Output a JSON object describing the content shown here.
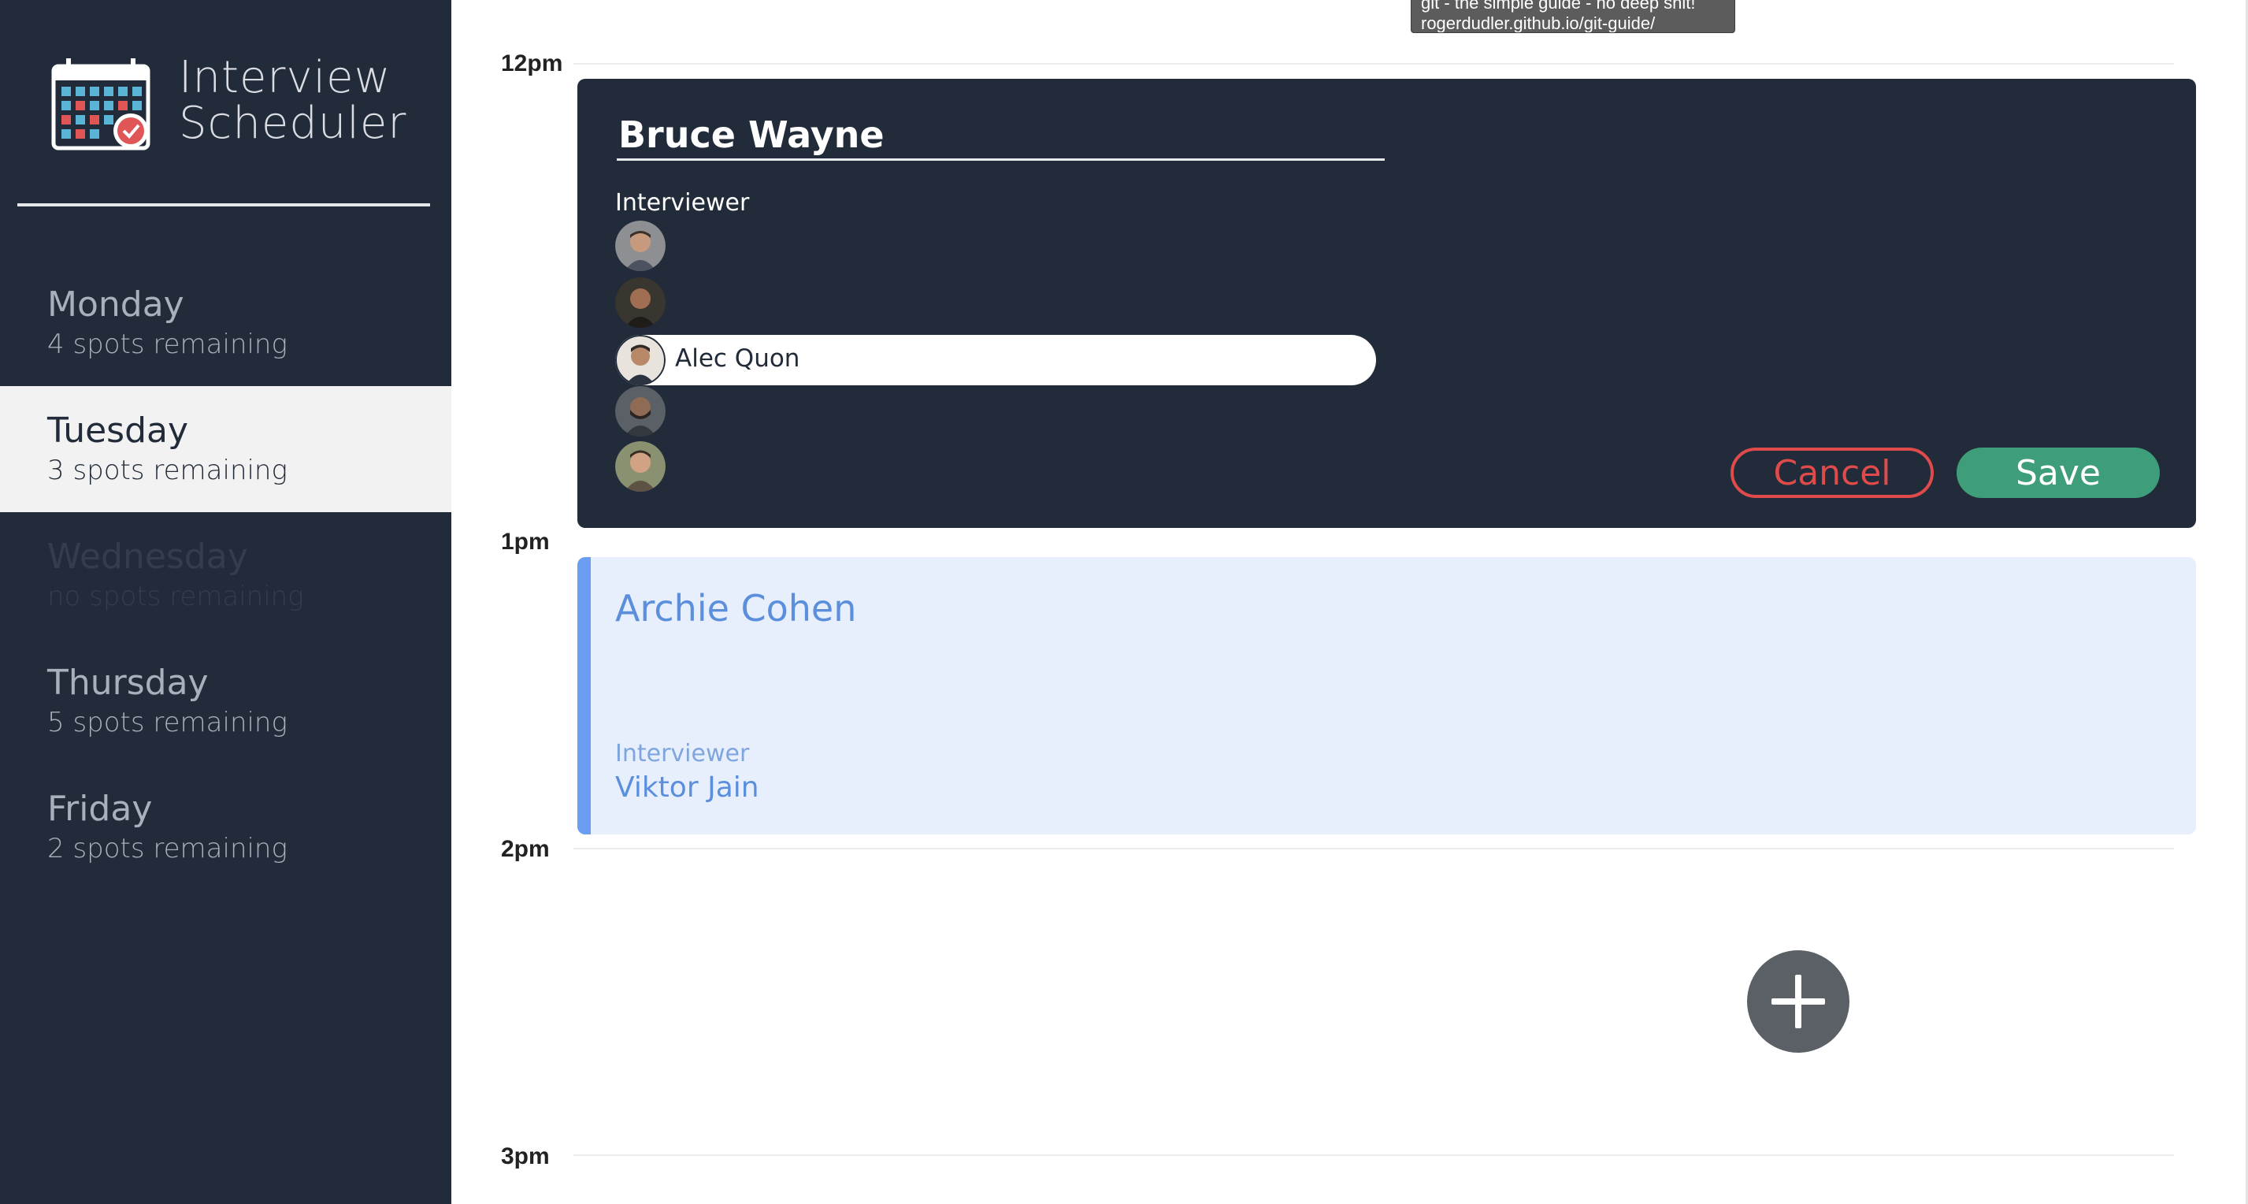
{
  "app": {
    "title_line1": "Interview",
    "title_line2": "Scheduler"
  },
  "days": [
    {
      "name": "Monday",
      "spots": "4 spots remaining",
      "state": "normal"
    },
    {
      "name": "Tuesday",
      "spots": "3 spots remaining",
      "state": "selected"
    },
    {
      "name": "Wednesday",
      "spots": "no spots remaining",
      "state": "full"
    },
    {
      "name": "Thursday",
      "spots": "5 spots remaining",
      "state": "normal"
    },
    {
      "name": "Friday",
      "spots": "2 spots remaining",
      "state": "normal"
    }
  ],
  "tooltip": {
    "line1": "git - the simple guide - no deep shit!",
    "line2": "rogerdudler.github.io/git-guide/"
  },
  "times": [
    "12pm",
    "1pm",
    "2pm",
    "3pm"
  ],
  "form": {
    "student_name": "Bruce Wayne",
    "interviewer_heading": "Interviewer",
    "selected_interviewer": "Alec Quon",
    "cancel_label": "Cancel",
    "save_label": "Save"
  },
  "appointment": {
    "student": "Archie Cohen",
    "interviewer_heading": "Interviewer",
    "interviewer": "Viktor Jain"
  },
  "colors": {
    "sidebar": "#222b39",
    "cancel": "#df4b4b",
    "save": "#3f9e7a",
    "appointment_bg": "#e7effd",
    "appointment_accent": "#6a9ef1"
  }
}
